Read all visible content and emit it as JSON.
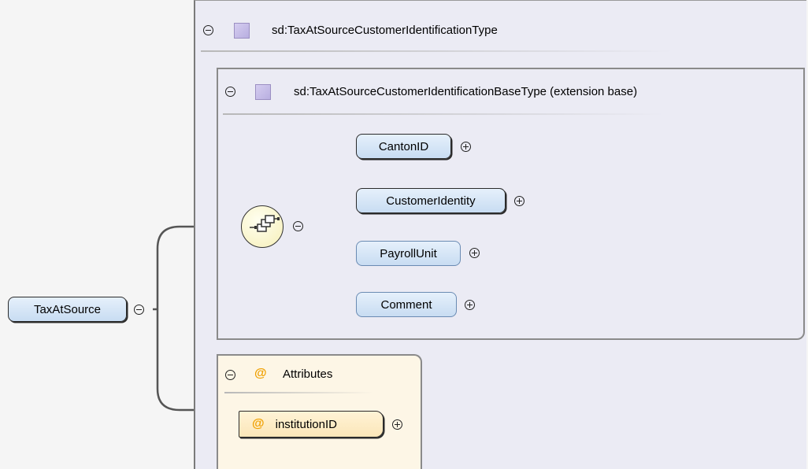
{
  "type_group": {
    "label": "sd:TaxAtSourceCustomerIdentificationType"
  },
  "extension_group": {
    "label": "sd:TaxAtSourceCustomerIdentificationBaseType (extension base)"
  },
  "root": {
    "label": "TaxAtSource"
  },
  "sequence": {
    "icon": "sequence-compositor-icon"
  },
  "elements": [
    {
      "label": "CantonID",
      "required": true
    },
    {
      "label": "CustomerIdentity",
      "required": true
    },
    {
      "label": "PayrollUnit",
      "required": false
    },
    {
      "label": "Comment",
      "required": false
    }
  ],
  "attributes": {
    "symbol": "@",
    "label": "Attributes",
    "items": [
      {
        "symbol": "@",
        "label": "institutionID"
      }
    ]
  },
  "colors": {
    "element_fill": "#d4e4f7",
    "attribute_fill": "#fdf6e6",
    "attribute_symbol": "#f0a000",
    "group_fill": "#ebebf4"
  }
}
